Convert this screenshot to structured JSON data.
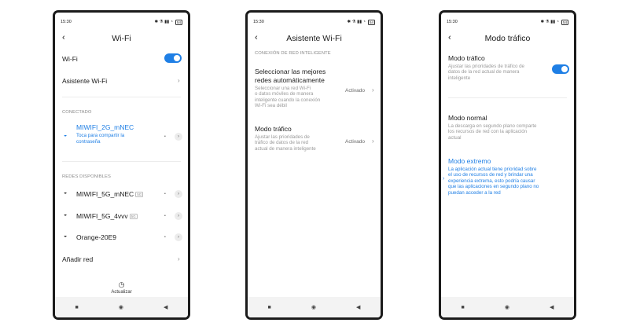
{
  "status": {
    "time": "15:30",
    "icons": "✱ ⚗ ▮▮ ◔",
    "battery": "54"
  },
  "nav": {
    "square": "■",
    "circle": "◉",
    "back": "◀"
  },
  "screen1": {
    "title": "Wi-Fi",
    "wifi_label": "Wi-Fi",
    "assistant_label": "Asistente Wi-Fi",
    "connected_header": "CONECTADO",
    "connected_name": "MIWIFI_2G_mNEC",
    "connected_sub1": "Toca para compartir la",
    "connected_sub2": "contraseña",
    "available_header": "REDES DISPONIBLES",
    "networks": [
      {
        "name": "MIWIFI_5G_mNEC",
        "badge": "5G"
      },
      {
        "name": "MIWIFI_5G_4vvv",
        "badge": "5G"
      },
      {
        "name": "Orange-20E9",
        "badge": ""
      }
    ],
    "add_label": "Añadir red",
    "refresh_label": "Actualizar"
  },
  "screen2": {
    "title": "Asistente Wi-Fi",
    "section": "CONEXIÓN DE RED INTELIGENTE",
    "item1_title1": "Seleccionar las mejores",
    "item1_title2": "redes automáticamente",
    "item1_desc": [
      "Seleccionar una red Wi-Fi",
      "o datos móviles de manera",
      "inteligente cuando la conexión",
      "Wi-Fi sea débil"
    ],
    "item1_value": "Activado",
    "item2_title": "Modo tráfico",
    "item2_desc": [
      "Ajustar las prioridades de",
      "tráfico de datos de la red",
      "actual de manera inteligente"
    ],
    "item2_value": "Activado"
  },
  "screen3": {
    "title": "Modo tráfico",
    "item1_title": "Modo tráfico",
    "item1_desc": [
      "Ajustar las prioridades de tráfico de",
      "datos de la red actual de manera",
      "inteligente"
    ],
    "item2_title": "Modo normal",
    "item2_desc": [
      "La descarga en segundo plano comparte",
      "los recursos de red con la aplicación",
      "actual"
    ],
    "item3_title": "Modo extremo",
    "item3_desc": [
      "La aplicación actual tiene prioridad sobre",
      "el uso de recursos de red y brindar una",
      "experiencia extrema, esto podría causar",
      "que las aplicaciones en segundo plano no",
      "puedan acceder a la red"
    ]
  }
}
